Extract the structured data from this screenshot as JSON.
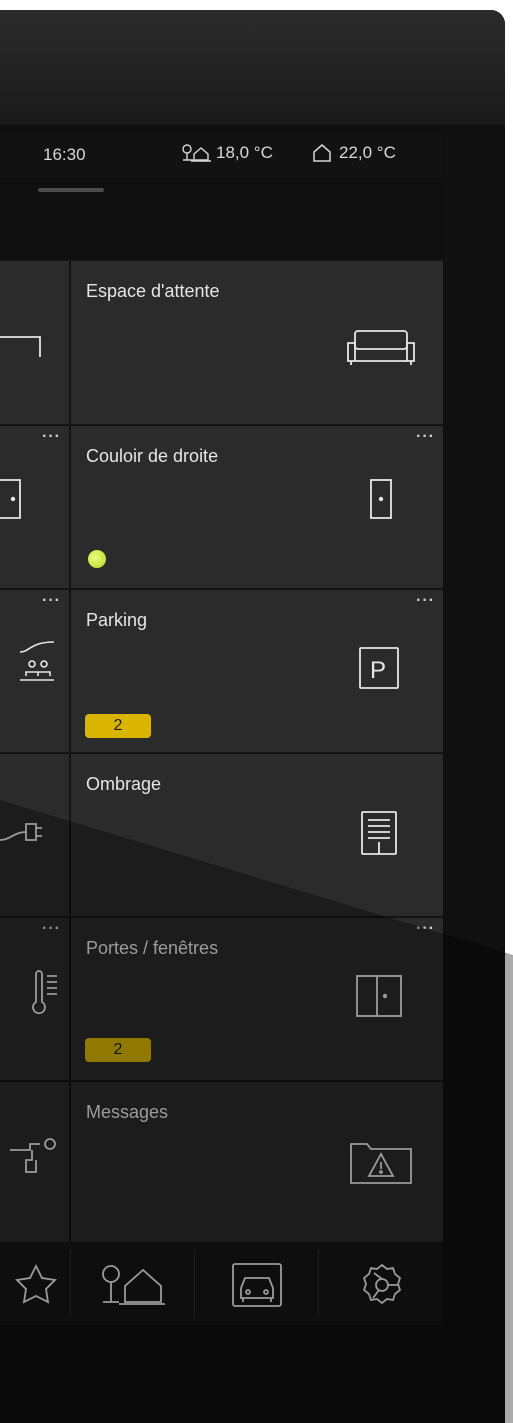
{
  "status_bar": {
    "time": "16:30",
    "outdoor_temp": "18,0 °C",
    "indoor_temp": "22,0 °C"
  },
  "tiles": [
    {
      "title": "Espace d'attente",
      "icon": "sofa-icon",
      "more": false
    },
    {
      "title": "Couloir de droite",
      "icon": "door-icon",
      "more": true,
      "status": "green-dot"
    },
    {
      "title": "Parking",
      "icon": "parking-icon",
      "more": true,
      "badge": "2"
    },
    {
      "title": "Ombrage",
      "icon": "blinds-icon",
      "more": false
    },
    {
      "title": "Portes / fenêtres",
      "icon": "window-icon",
      "more": true,
      "badge": "2"
    },
    {
      "title": "Messages",
      "icon": "warning-folder-icon",
      "more": false
    }
  ],
  "left_tiles_more": [
    false,
    true,
    true,
    false,
    true,
    false
  ],
  "more_label": "···",
  "nav": [
    "favorites-star-icon",
    "home-weather-icon",
    "car-icon",
    "settings-icon"
  ],
  "colors": {
    "tile": "#2b2b2b",
    "accent_yellow": "#d9b400",
    "status_green": "#b8d424"
  }
}
